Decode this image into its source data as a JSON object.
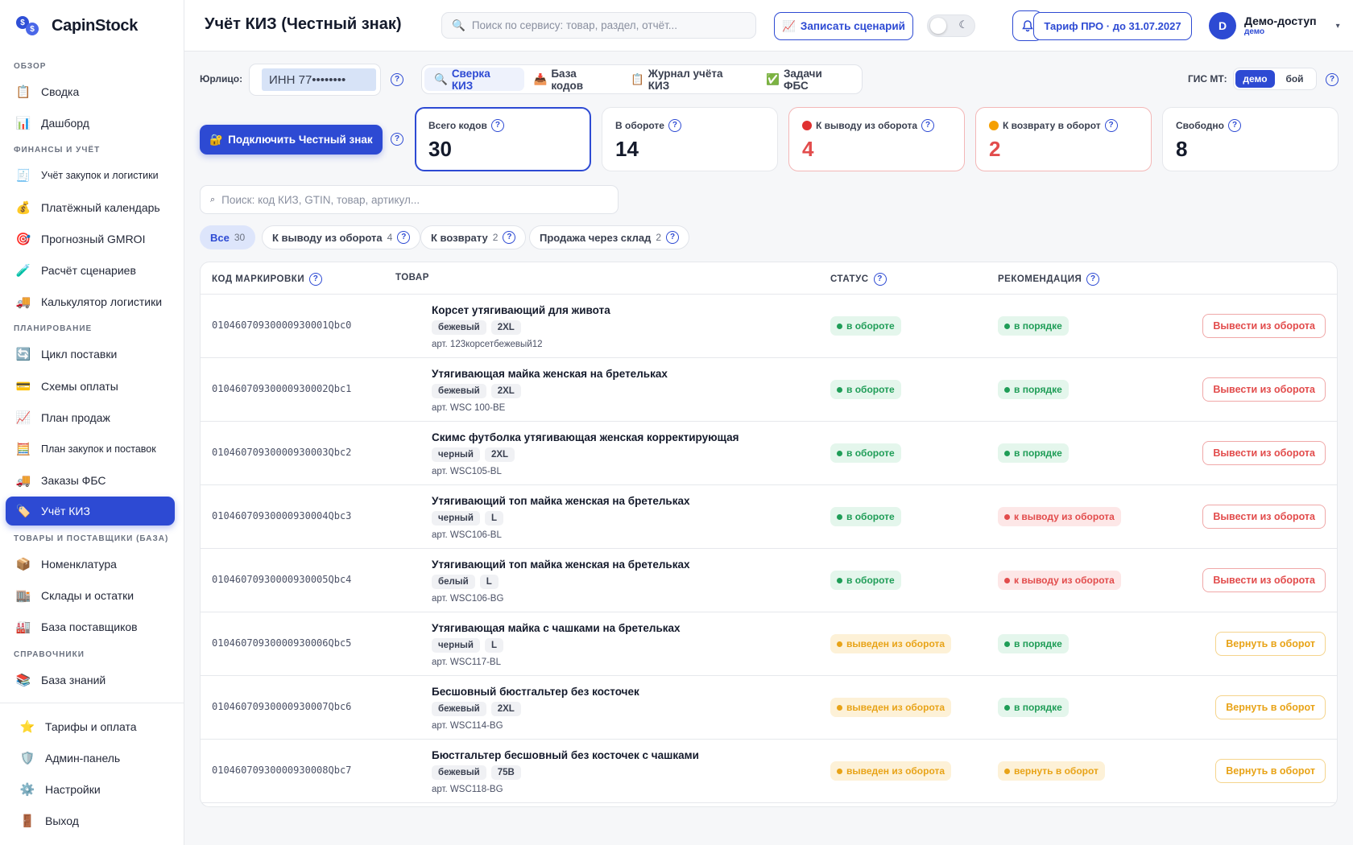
{
  "brand": {
    "name": "CapinStock"
  },
  "sidebar": {
    "sections": [
      {
        "title": "ОБЗОР"
      },
      {
        "title": "ФИНАНСЫ И УЧЁТ"
      },
      {
        "title": "ПЛАНИРОВАНИЕ"
      },
      {
        "title": "ТОВАРЫ И ПОСТАВЩИКИ (БАЗА)"
      },
      {
        "title": "СПРАВОЧНИКИ"
      }
    ],
    "items": [
      {
        "label": "Сводка",
        "icon": "clipboard-icon"
      },
      {
        "label": "Дашборд",
        "icon": "bar-chart-icon"
      },
      {
        "label": "Учёт закупок и логистики",
        "icon": "receipt-icon"
      },
      {
        "label": "Платёжный календарь",
        "icon": "money-bag-icon"
      },
      {
        "label": "Прогнозный GMROI",
        "icon": "target-icon"
      },
      {
        "label": "Расчёт сценариев",
        "icon": "test-tube-icon"
      },
      {
        "label": "Калькулятор логистики",
        "icon": "truck-icon"
      },
      {
        "label": "Цикл поставки",
        "icon": "cycle-icon"
      },
      {
        "label": "Схемы оплаты",
        "icon": "credit-card-icon"
      },
      {
        "label": "План продаж",
        "icon": "line-chart-icon"
      },
      {
        "label": "План закупок и поставок",
        "icon": "abacus-icon"
      },
      {
        "label": "Заказы ФБС",
        "icon": "truck-icon"
      },
      {
        "label": "Учёт КИЗ",
        "icon": "label-icon"
      },
      {
        "label": "Номенклатура",
        "icon": "package-icon"
      },
      {
        "label": "Склады и остатки",
        "icon": "warehouse-icon"
      },
      {
        "label": "База поставщиков",
        "icon": "factory-icon"
      },
      {
        "label": "База знаний",
        "icon": "books-icon"
      }
    ],
    "footer": [
      {
        "label": "Тарифы и оплата",
        "icon": "star-icon"
      },
      {
        "label": "Админ-панель",
        "icon": "shield-icon"
      },
      {
        "label": "Настройки",
        "icon": "gear-icon"
      },
      {
        "label": "Выход",
        "icon": "door-icon"
      }
    ]
  },
  "header": {
    "title": "Учёт КИЗ (Честный знак)",
    "search_placeholder": "Поиск по сервису: товар, раздел, отчёт...",
    "record_button": "Записать сценарий",
    "tariff_button": "Тариф ПРО · до 31.07.2027",
    "user": {
      "initial": "D",
      "name": "Демо-доступ",
      "role": "демо"
    }
  },
  "toolbar": {
    "entity_label": "Юрлицо:",
    "entity_value": "ИНН 77••••••••",
    "tabs": [
      {
        "label": "Сверка КИЗ",
        "icon": "magnifier-icon"
      },
      {
        "label": "База кодов",
        "icon": "inbox-icon"
      },
      {
        "label": "Журнал учёта КИЗ",
        "icon": "clipboard-icon"
      },
      {
        "label": "Задачи ФБС",
        "icon": "check-box-icon"
      }
    ],
    "gis_label": "ГИС МТ:",
    "gis_options": [
      "демо",
      "бой"
    ]
  },
  "connect_button": "Подключить Честный знак",
  "stats": [
    {
      "label": "Всего кодов",
      "value": "30"
    },
    {
      "label": "В обороте",
      "value": "14"
    },
    {
      "label": "К выводу из оборота",
      "value": "4",
      "dot": "#e03131"
    },
    {
      "label": "К возврату в оборот",
      "value": "2",
      "dot": "#f59f00"
    },
    {
      "label": "Свободно",
      "value": "8"
    }
  ],
  "kiz_search_placeholder": "Поиск: код КИЗ, GTIN, товар, артикул...",
  "filters": [
    {
      "label": "Все",
      "count": "30"
    },
    {
      "label": "К выводу из оборота",
      "count": "4"
    },
    {
      "label": "К возврату",
      "count": "2"
    },
    {
      "label": "Продажа через склад",
      "count": "2"
    }
  ],
  "table": {
    "columns": {
      "code": "КОД МАРКИРОВКИ",
      "product": "ТОВАР",
      "status": "СТАТУС",
      "recommendation": "РЕКОМЕНДАЦИЯ"
    },
    "rows": [
      {
        "code": "01046070930000930001Qbc0",
        "name": "Корсет утягивающий для живота",
        "color": "бежевый",
        "size": "2XL",
        "sku": "арт. 123корсетбежевый12",
        "status": "в обороте",
        "status_tone": "green",
        "rec": "в порядке",
        "rec_tone": "green",
        "action": "Вывести из оборота",
        "action_tone": "red"
      },
      {
        "code": "01046070930000930002Qbc1",
        "name": "Утягивающая майка женская на бретельках",
        "color": "бежевый",
        "size": "2XL",
        "sku": "арт. WSC 100-BE",
        "status": "в обороте",
        "status_tone": "green",
        "rec": "в порядке",
        "rec_tone": "green",
        "action": "Вывести из оборота",
        "action_tone": "red"
      },
      {
        "code": "01046070930000930003Qbc2",
        "name": "Скимс футболка утягивающая женская корректирующая",
        "color": "черный",
        "size": "2XL",
        "sku": "арт. WSC105-BL",
        "status": "в обороте",
        "status_tone": "green",
        "rec": "в порядке",
        "rec_tone": "green",
        "action": "Вывести из оборота",
        "action_tone": "red"
      },
      {
        "code": "01046070930000930004Qbc3",
        "name": "Утягивающий топ майка женская на бретельках",
        "color": "черный",
        "size": "L",
        "sku": "арт. WSC106-BL",
        "status": "в обороте",
        "status_tone": "green",
        "rec": "к выводу из оборота",
        "rec_tone": "red",
        "action": "Вывести из оборота",
        "action_tone": "red"
      },
      {
        "code": "01046070930000930005Qbc4",
        "name": "Утягивающий топ майка женская на бретельках",
        "color": "белый",
        "size": "L",
        "sku": "арт. WSC106-BG",
        "status": "в обороте",
        "status_tone": "green",
        "rec": "к выводу из оборота",
        "rec_tone": "red",
        "action": "Вывести из оборота",
        "action_tone": "red"
      },
      {
        "code": "01046070930000930006Qbc5",
        "name": "Утягивающая майка с чашками на бретельках",
        "color": "черный",
        "size": "L",
        "sku": "арт. WSC117-BL",
        "status": "выведен из оборота",
        "status_tone": "yellow",
        "rec": "в порядке",
        "rec_tone": "green",
        "action": "Вернуть в оборот",
        "action_tone": "yellow"
      },
      {
        "code": "01046070930000930007Qbc6",
        "name": "Бесшовный бюстгальтер без косточек",
        "color": "бежевый",
        "size": "2XL",
        "sku": "арт. WSC114-BG",
        "status": "выведен из оборота",
        "status_tone": "yellow",
        "rec": "в порядке",
        "rec_tone": "green",
        "action": "Вернуть в оборот",
        "action_tone": "yellow"
      },
      {
        "code": "01046070930000930008Qbc7",
        "name": "Бюстгальтер бесшовный без косточек с чашками",
        "color": "бежевый",
        "size": "75B",
        "sku": "арт. WSC118-BG",
        "status": "выведен из оборота",
        "status_tone": "yellow",
        "rec": "вернуть в оборот",
        "rec_tone": "yellow",
        "action": "Вернуть в оборот",
        "action_tone": "yellow"
      }
    ]
  }
}
